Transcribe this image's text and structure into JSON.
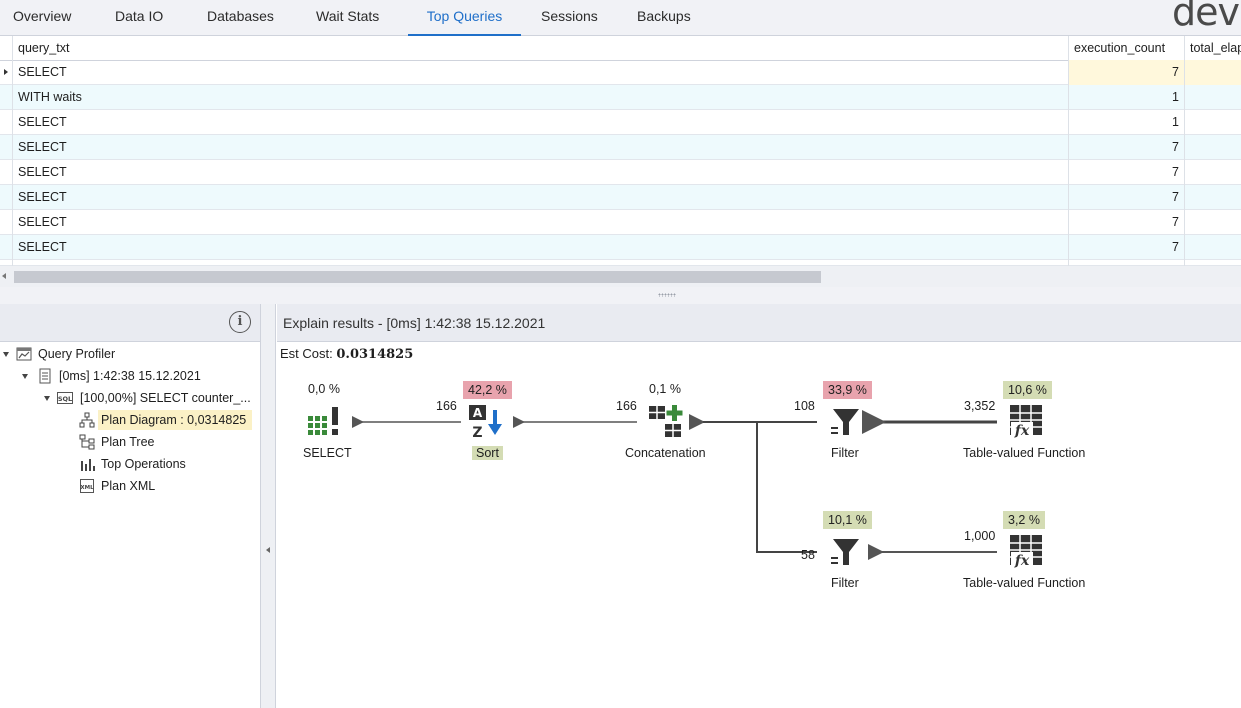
{
  "tabs": [
    {
      "label": "Overview"
    },
    {
      "label": "Data IO"
    },
    {
      "label": "Databases"
    },
    {
      "label": "Wait Stats"
    },
    {
      "label": "Top Queries",
      "active": true
    },
    {
      "label": "Sessions"
    },
    {
      "label": "Backups"
    }
  ],
  "logo_text": "devo",
  "grid": {
    "columns": [
      "query_txt",
      "execution_count",
      "total_elap"
    ],
    "rows": [
      {
        "query_txt": "SELECT",
        "execution_count": "7"
      },
      {
        "query_txt": "WITH waits",
        "execution_count": "1"
      },
      {
        "query_txt": "SELECT",
        "execution_count": "1"
      },
      {
        "query_txt": "SELECT",
        "execution_count": "7"
      },
      {
        "query_txt": "SELECT",
        "execution_count": "7"
      },
      {
        "query_txt": "SELECT",
        "execution_count": "7"
      },
      {
        "query_txt": "SELECT",
        "execution_count": "7"
      },
      {
        "query_txt": "SELECT",
        "execution_count": "7"
      }
    ]
  },
  "tree": {
    "root": "Query Profiler",
    "session": "[0ms] 1:42:38 15.12.2021",
    "statement": "[100,00%] SELECT counter_...",
    "items": [
      {
        "label": "Plan Diagram : 0,0314825",
        "icon": "plan-diagram-icon",
        "selected": true
      },
      {
        "label": "Plan Tree",
        "icon": "plan-tree-icon"
      },
      {
        "label": "Top Operations",
        "icon": "top-operations-icon"
      },
      {
        "label": "Plan XML",
        "icon": "plan-xml-icon"
      }
    ]
  },
  "explain": {
    "title": "Explain results - [0ms] 1:42:38 15.12.2021",
    "est_cost_label": "Est Cost:",
    "est_cost_value": "0.0314825",
    "operators": {
      "select": {
        "name": "SELECT",
        "pct": "0,0 %",
        "icon": "select-operator-icon"
      },
      "sort": {
        "name": "Sort",
        "pct": "42,2 %",
        "icon": "sort-operator-icon",
        "rows_in": "166"
      },
      "concat": {
        "name": "Concatenation",
        "pct": "0,1 %",
        "icon": "concatenation-operator-icon",
        "rows_in": "166"
      },
      "filter1": {
        "name": "Filter",
        "pct": "33,9 %",
        "icon": "filter-operator-icon",
        "rows_in": "108"
      },
      "tvf1": {
        "name": "Table-valued Function",
        "pct": "10,6 %",
        "icon": "table-valued-function-icon",
        "rows_in": "3,352"
      },
      "filter2": {
        "name": "Filter",
        "pct": "10,1 %",
        "icon": "filter-operator-icon",
        "rows_in": "58"
      },
      "tvf2": {
        "name": "Table-valued Function",
        "pct": "3,2 %",
        "icon": "table-valued-function-icon",
        "rows_in": "1,000"
      }
    }
  },
  "colors": {
    "accent": "#1f6fc9",
    "cost_high": "#e8a3ad",
    "cost_low": "#d4dcb4",
    "selection": "#fbf1c6"
  }
}
